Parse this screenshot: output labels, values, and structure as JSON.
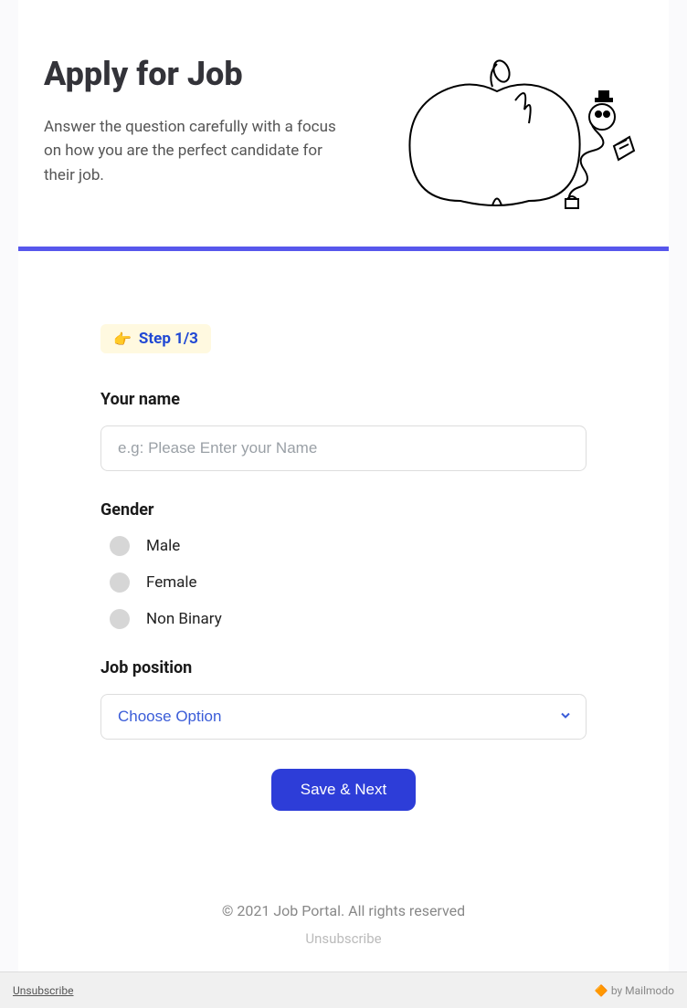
{
  "header": {
    "title": "Apply for Job",
    "subtitle": "Answer the question carefully with a focus on how you are the perfect candidate for their job."
  },
  "step": {
    "icon": "👉",
    "label": "Step 1/3"
  },
  "form": {
    "name": {
      "label": "Your name",
      "placeholder": "e.g: Please Enter your Name"
    },
    "gender": {
      "label": "Gender",
      "options": [
        "Male",
        "Female",
        "Non Binary"
      ]
    },
    "position": {
      "label": "Job position",
      "selected": "Choose Option"
    },
    "submit": "Save & Next"
  },
  "footer": {
    "copyright": "© 2021 Job Portal. All rights reserved",
    "unsubscribe": "Unsubscribe"
  },
  "bottom": {
    "left": "Unsubscribe",
    "right": "🔶 by Mailmodo"
  }
}
